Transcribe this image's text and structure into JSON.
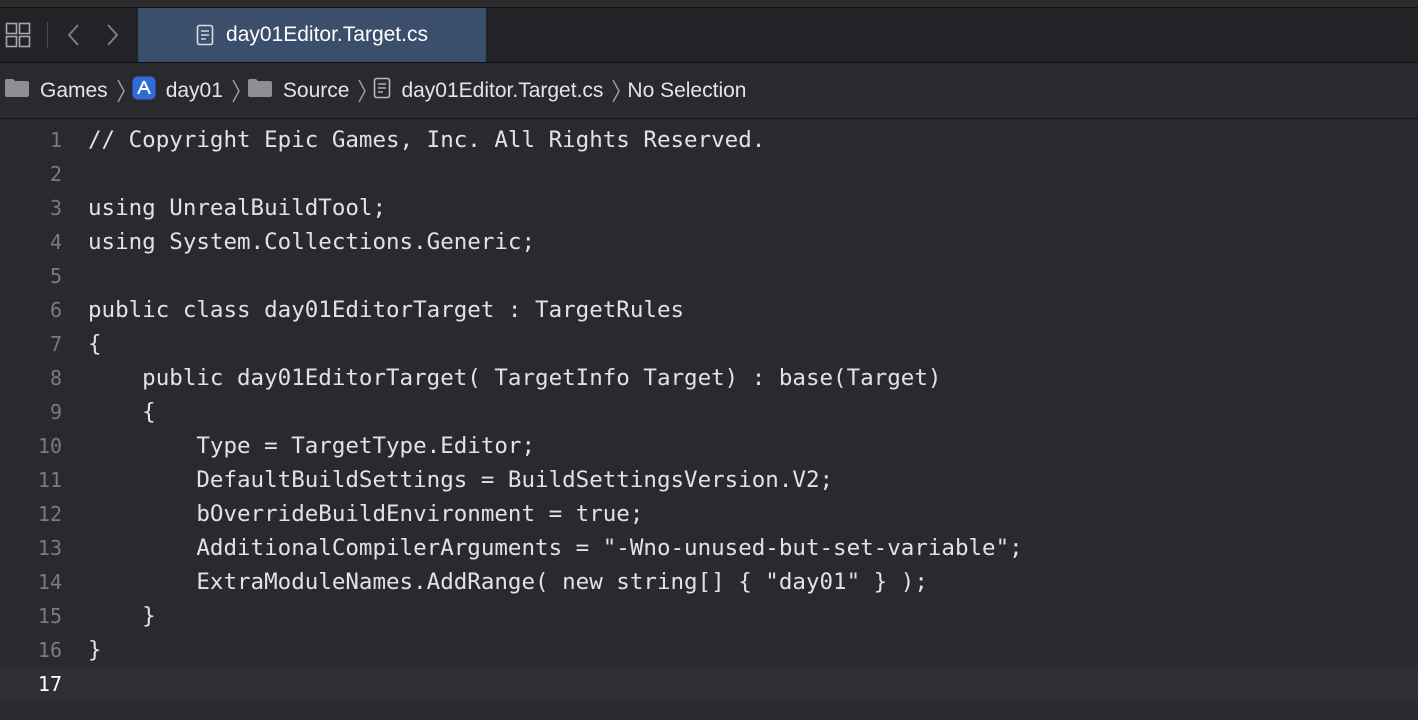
{
  "window": {
    "tab": {
      "title": "day01Editor.Target.cs",
      "icon": "document-icon"
    },
    "toolbar_icons": [
      "grid-icon",
      "back-icon",
      "forward-icon"
    ]
  },
  "breadcrumb": {
    "items": [
      {
        "label": "Games",
        "icon": "folder-icon"
      },
      {
        "label": "day01",
        "icon": "app-project-icon"
      },
      {
        "label": "Source",
        "icon": "folder-icon"
      },
      {
        "label": "day01Editor.Target.cs",
        "icon": "document-icon"
      },
      {
        "label": "No Selection",
        "icon": ""
      }
    ]
  },
  "editor": {
    "current_line": 17,
    "lines": [
      {
        "num": "1",
        "text": "// Copyright Epic Games, Inc. All Rights Reserved."
      },
      {
        "num": "2",
        "text": ""
      },
      {
        "num": "3",
        "text": "using UnrealBuildTool;"
      },
      {
        "num": "4",
        "text": "using System.Collections.Generic;"
      },
      {
        "num": "5",
        "text": ""
      },
      {
        "num": "6",
        "text": "public class day01EditorTarget : TargetRules"
      },
      {
        "num": "7",
        "text": "{"
      },
      {
        "num": "8",
        "text": "    public day01EditorTarget( TargetInfo Target) : base(Target)"
      },
      {
        "num": "9",
        "text": "    {"
      },
      {
        "num": "10",
        "text": "        Type = TargetType.Editor;"
      },
      {
        "num": "11",
        "text": "        DefaultBuildSettings = BuildSettingsVersion.V2;"
      },
      {
        "num": "12",
        "text": "        bOverrideBuildEnvironment = true;"
      },
      {
        "num": "13",
        "text": "        AdditionalCompilerArguments = \"-Wno-unused-but-set-variable\";"
      },
      {
        "num": "14",
        "text": "        ExtraModuleNames.AddRange( new string[] { \"day01\" } );"
      },
      {
        "num": "15",
        "text": "    }"
      },
      {
        "num": "16",
        "text": "}"
      },
      {
        "num": "17",
        "text": ""
      }
    ]
  },
  "colors": {
    "editor_bg": "#292a30",
    "tab_active_bg": "#3b4f6c",
    "current_line_bg": "#2f3036"
  }
}
